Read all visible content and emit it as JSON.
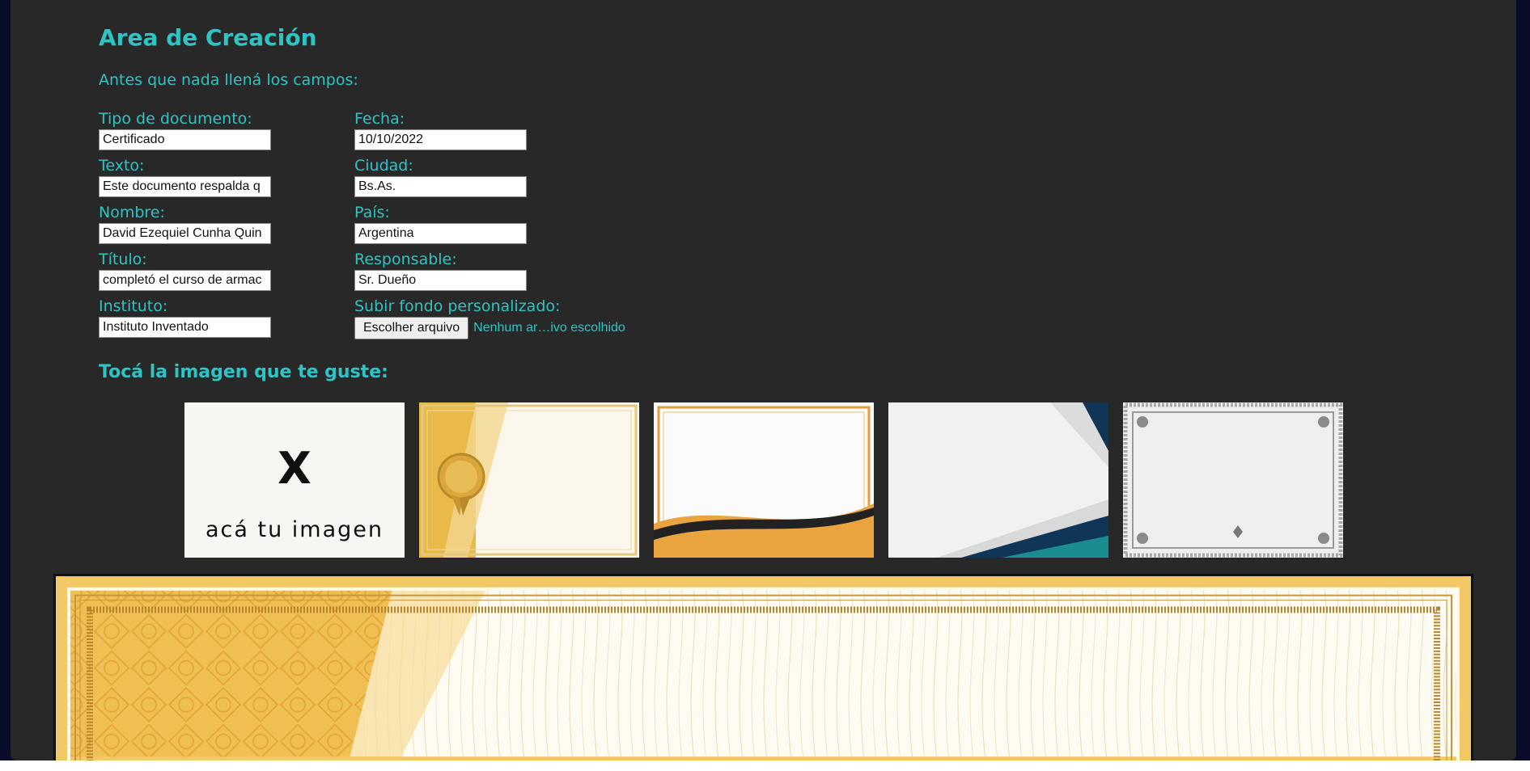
{
  "page": {
    "title": "Area de Creación",
    "intro": "Antes que nada llená los campos:",
    "choose_heading": "Tocá la imagen que te guste:"
  },
  "form": {
    "tipo": {
      "label": "Tipo de documento:",
      "value": "Certificado"
    },
    "texto": {
      "label": "Texto:",
      "value": "Este documento respalda q"
    },
    "nombre": {
      "label": "Nombre:",
      "value": "David Ezequiel Cunha Quin"
    },
    "titulo": {
      "label": "Título:",
      "value": "completó el curso de armac"
    },
    "instituto": {
      "label": "Instituto:",
      "value": "Instituto Inventado"
    },
    "fecha": {
      "label": "Fecha:",
      "value": "10/10/2022"
    },
    "ciudad": {
      "label": "Ciudad:",
      "value": "Bs.As."
    },
    "pais": {
      "label": "País:",
      "value": "Argentina"
    },
    "responsable": {
      "label": "Responsable:",
      "value": "Sr. Dueño"
    },
    "upload": {
      "label": "Subir fondo personalizado:",
      "button": "Escolher arquivo",
      "filename": "Nenhum ar…ivo escolhido"
    }
  },
  "templates": {
    "custom": {
      "mark": "X",
      "caption": "acá tu imagen"
    },
    "items": [
      "custom-image",
      "gold-seal",
      "gold-wave",
      "blue-corner",
      "silver-ornate"
    ]
  },
  "colors": {
    "accent": "#2ec4c4",
    "panel": "#282828",
    "gold": "#e8b04a"
  }
}
